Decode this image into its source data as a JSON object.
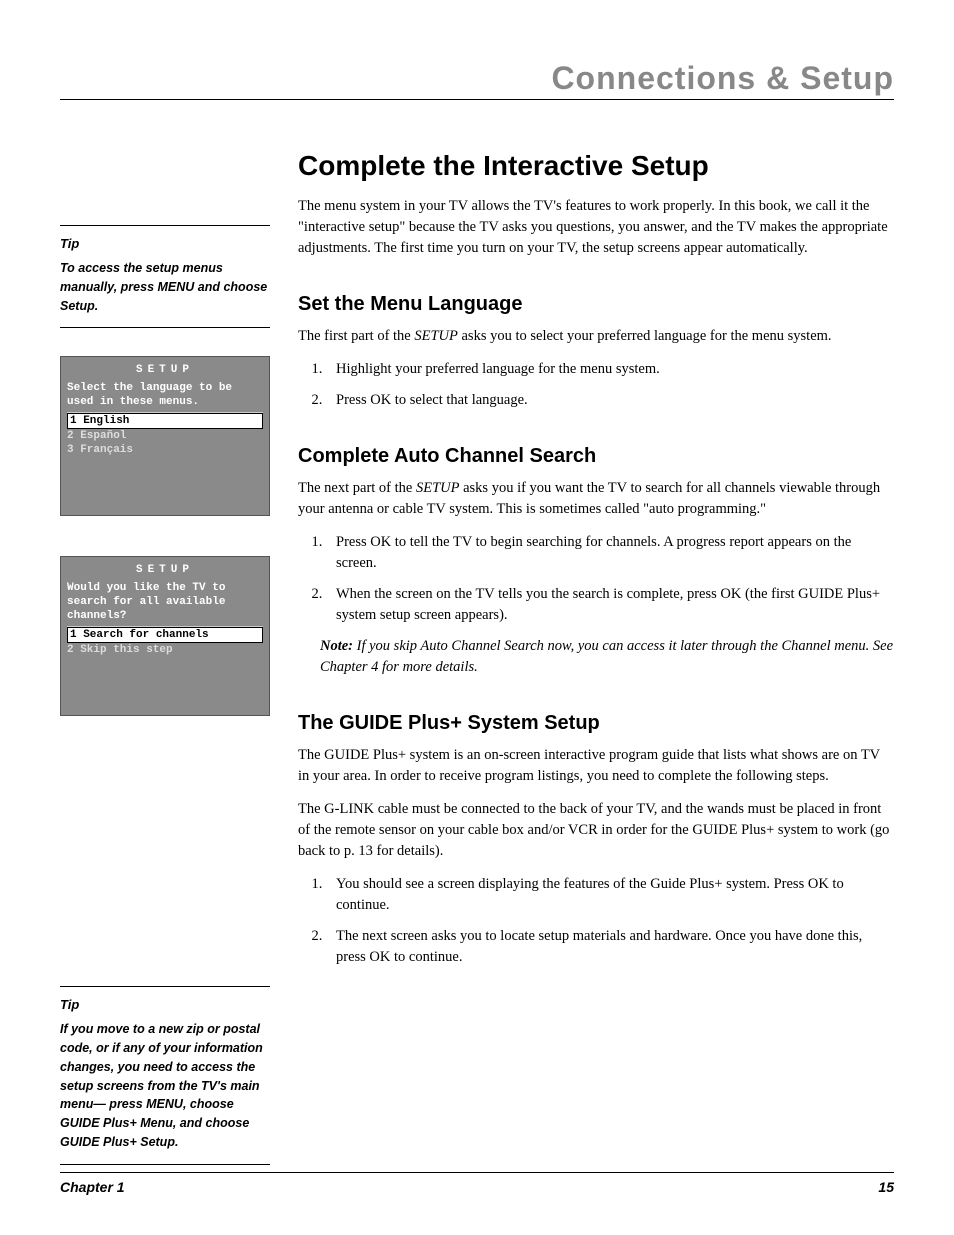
{
  "header": "Connections & Setup",
  "title": "Complete the Interactive Setup",
  "intro": "The menu system in your TV allows the TV's features to work properly. In this book, we call it the \"interactive setup\" because the TV asks you questions, you answer, and the TV makes the appropriate adjustments. The first time you turn on your TV, the setup screens appear automatically.",
  "tip1": {
    "title": "Tip",
    "body": "To access the setup menus manually, press MENU and choose Setup."
  },
  "screen1": {
    "title": "SETUP",
    "prompt": "Select the language to be used in these menus.",
    "opt1": "1 English",
    "opt2": "2 Español",
    "opt3": "3 Français"
  },
  "sec1": {
    "title": "Set the Menu Language",
    "p_a": "The first part of the ",
    "setup_word": "SETUP",
    "p_b": " asks you to select your preferred language for the menu system.",
    "li1": "Highlight your preferred language for the menu system.",
    "li2": "Press OK to select that language."
  },
  "screen2": {
    "title": "SETUP",
    "prompt": "Would you like the TV to search for all available channels?",
    "opt1": "1 Search for channels",
    "opt2": "2 Skip this step"
  },
  "sec2": {
    "title": "Complete Auto Channel Search",
    "p_a": "The next part of the ",
    "setup_word": "SETUP",
    "p_b": " asks you if you want the TV to search for all channels viewable through your antenna or cable TV system. This is sometimes called \"auto programming.\"",
    "li1": "Press OK to tell the TV to begin searching for channels. A progress report appears on the screen.",
    "li2": "When the screen on the TV tells you the search is complete, press OK (the first GUIDE Plus+ system setup screen appears).",
    "note_label": "Note:",
    "note_body": "  If you skip Auto Channel Search now, you can access it later through the Channel menu. See Chapter 4 for more details."
  },
  "tip2": {
    "title": "Tip",
    "body": "If you move to a new zip or postal code, or if any of your information changes, you need to access the setup screens from the TV's main menu— press MENU, choose GUIDE Plus+ Menu, and choose GUIDE Plus+ Setup."
  },
  "sec3": {
    "title": "The GUIDE Plus+ System Setup",
    "p1": "The GUIDE Plus+ system is an on-screen interactive program guide that lists what shows are on TV in your area. In order to receive program listings, you need to complete the following steps.",
    "p2": "The G-LINK cable must be connected to the back of your TV, and the wands must be placed in front of the remote sensor on your cable box and/or VCR in order for the GUIDE Plus+ system to work (go back to p. 13 for details).",
    "li1": "You should see a screen displaying the features of the Guide Plus+ system. Press OK to continue.",
    "li2": "The next screen asks you to locate setup materials and hardware. Once you have done this, press OK to continue."
  },
  "footer": {
    "chapter": "Chapter 1",
    "page": "15"
  }
}
